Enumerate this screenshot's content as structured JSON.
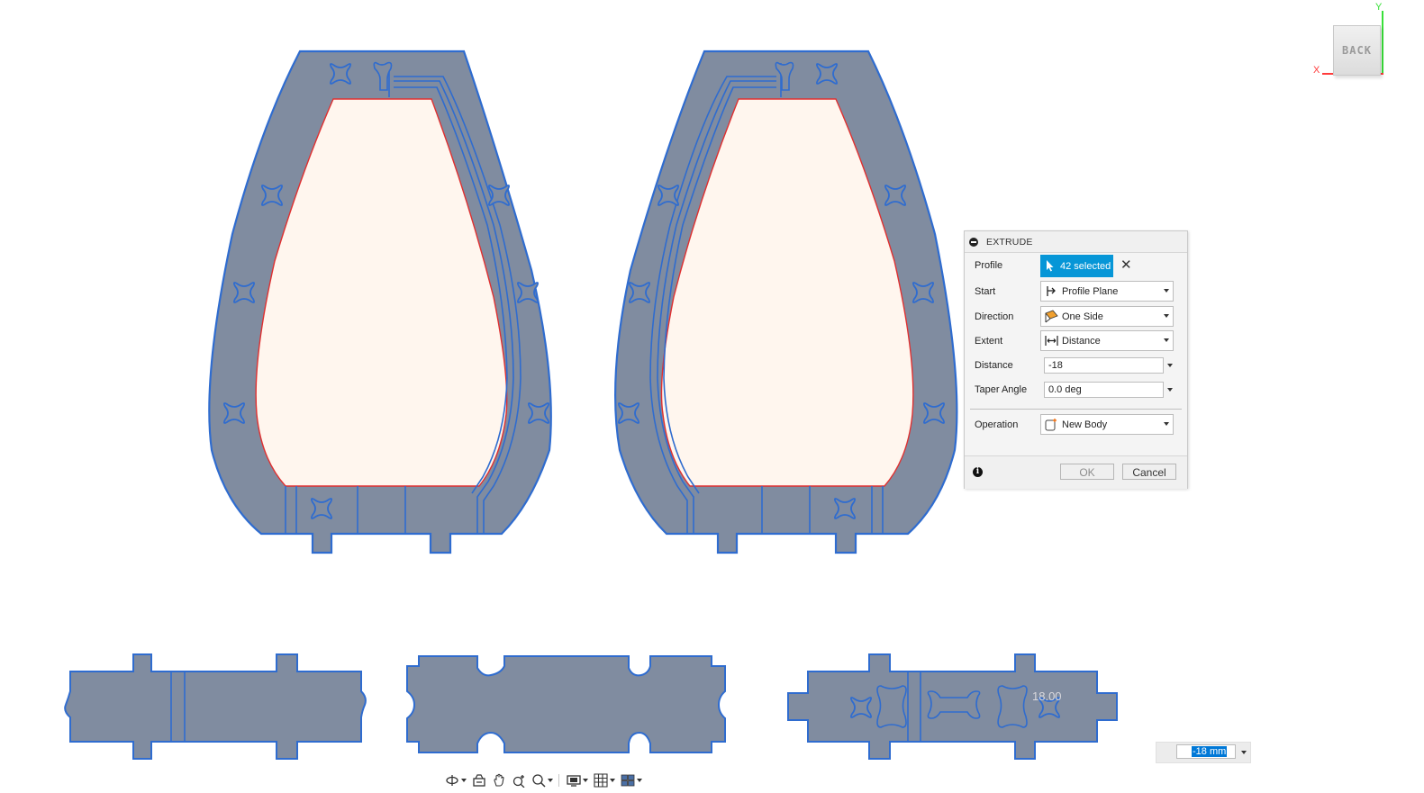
{
  "viewcube": {
    "face_label": "BACK",
    "x_axis": "X",
    "y_axis": "Y"
  },
  "dialog": {
    "title": "EXTRUDE",
    "rows": {
      "profile": {
        "label": "Profile",
        "value": "42 selected"
      },
      "start": {
        "label": "Start",
        "value": "Profile Plane"
      },
      "direction": {
        "label": "Direction",
        "value": "One Side"
      },
      "extent": {
        "label": "Extent",
        "value": "Distance"
      },
      "distance": {
        "label": "Distance",
        "value": "-18"
      },
      "taper": {
        "label": "Taper Angle",
        "value": "0.0 deg"
      },
      "operation": {
        "label": "Operation",
        "value": "New Body"
      }
    },
    "ok_label": "OK",
    "cancel_label": "Cancel"
  },
  "canvas": {
    "measure_label": "18.00",
    "distance_input": "-18 mm"
  },
  "navbar": {
    "tools": [
      "orbit-icon",
      "look-at-icon",
      "pan-icon",
      "zoom-icon",
      "fit-icon",
      "display-settings-icon",
      "grid-icon",
      "viewports-icon"
    ]
  },
  "colors": {
    "body_fill": "#808ca0",
    "body_edge": "#2f6ccf",
    "window_fill": "#fff6ee",
    "window_edge": "#e03030",
    "accent": "#0696d7"
  }
}
